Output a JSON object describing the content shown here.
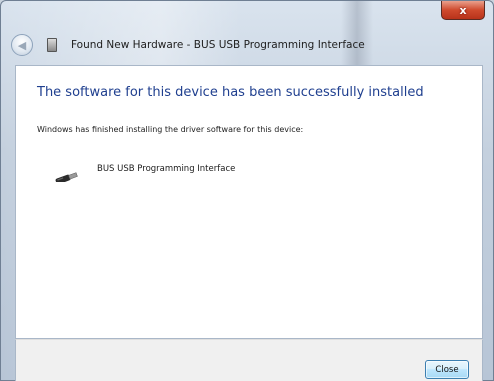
{
  "window": {
    "title": "Found New Hardware - BUS USB Programming Interface",
    "close_glyph": "x"
  },
  "content": {
    "headline": "The software for this device has been successfully installed",
    "subtext": "Windows has finished installing the driver software for this device:",
    "device": {
      "name": "BUS USB Programming Interface",
      "icon": "usb-device-icon"
    }
  },
  "footer": {
    "close_label": "Close"
  },
  "colors": {
    "headline": "#1f3f8f",
    "close_button_border": "#3c7fb1",
    "window_close_red": "#cf4a2d"
  }
}
